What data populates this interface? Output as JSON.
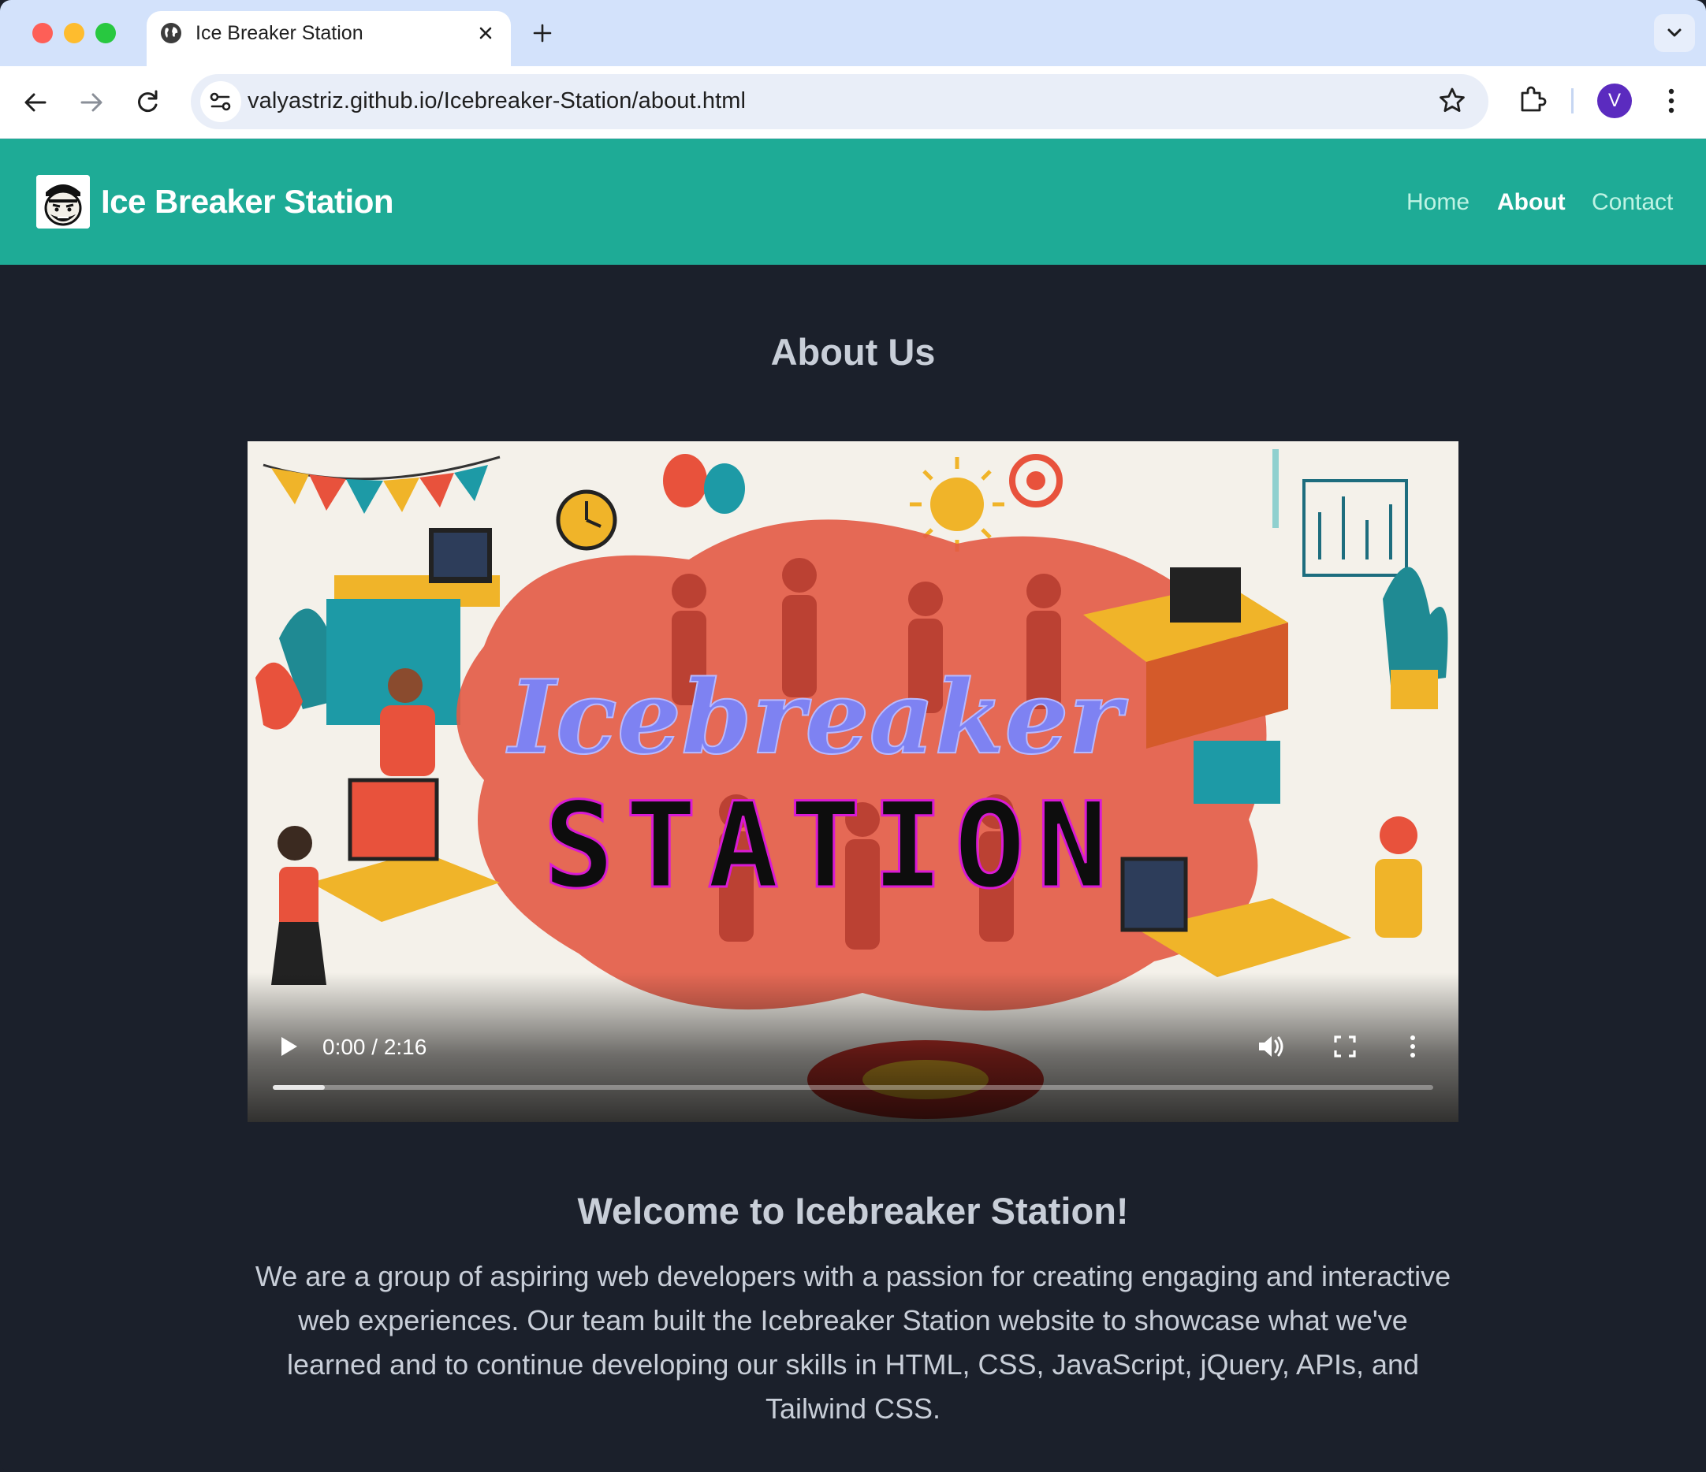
{
  "browser": {
    "tab_title": "Ice Breaker Station",
    "url": "valyastriz.github.io/Icebreaker-Station/about.html",
    "profile_initial": "V"
  },
  "header": {
    "brand": "Ice Breaker Station",
    "nav": [
      {
        "label": "Home",
        "active": false
      },
      {
        "label": "About",
        "active": true
      },
      {
        "label": "Contact",
        "active": false
      }
    ],
    "color": "#1eab96"
  },
  "main": {
    "title": "About Us",
    "video": {
      "poster_text_script": "Icebreaker",
      "poster_text_block": "STATION",
      "time": "0:00 / 2:16",
      "progress_fraction": 0.045
    },
    "welcome_heading": "Welcome to Icebreaker Station!",
    "intro": "We are a group of aspiring web developers with a passion for creating engaging and interactive web experiences. Our team built the Icebreaker Station website to showcase what we've learned and to continue developing our skills in HTML, CSS, JavaScript, jQuery, APIs, and Tailwind CSS."
  },
  "colors": {
    "page_bg": "#1b202b",
    "text": "#c8ced8",
    "accent_red": "#e8523c"
  }
}
